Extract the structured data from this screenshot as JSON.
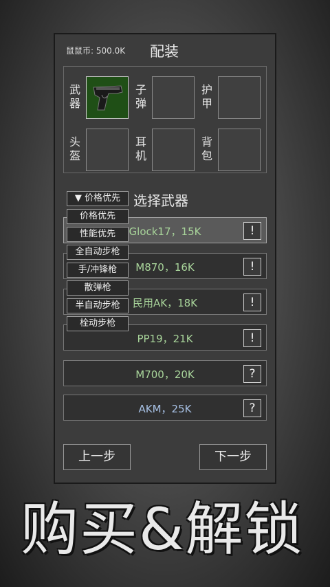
{
  "header": {
    "coins": "鼠鼠币: 500.0K",
    "title": "配装"
  },
  "slots": [
    {
      "label": "武器",
      "filled": true,
      "icon": "pistol-icon"
    },
    {
      "label": "子弹",
      "filled": false
    },
    {
      "label": "护甲",
      "filled": false
    },
    {
      "label": "头盔",
      "filled": false
    },
    {
      "label": "耳机",
      "filled": false
    },
    {
      "label": "背包",
      "filled": false
    }
  ],
  "weapon_select": {
    "title": "选择武器",
    "sort_selected": "▼ 价格优先",
    "sort_options": [
      "价格优先",
      "性能优先",
      "全自动步枪",
      "手/冲锋枪",
      "散弹枪",
      "半自动步枪",
      "栓动步枪"
    ],
    "weapons": [
      {
        "name": "Glock17，15K",
        "info": "!"
      },
      {
        "name": "M870，16K",
        "info": "!"
      },
      {
        "name": "民用AK，18K",
        "info": "!"
      },
      {
        "name": "PP19，21K",
        "info": "!"
      },
      {
        "name": "M700，20K",
        "info": "?"
      },
      {
        "name": "AKM，25K",
        "info": "?"
      }
    ]
  },
  "nav": {
    "prev": "上一步",
    "next": "下一步"
  },
  "banner": "购买&解锁",
  "colors": {
    "panel": "#3c3c3c",
    "unlocked_text": "#a8d49a",
    "locked_text": "#a8c2e6",
    "slot_filled": "#1f4f16"
  }
}
